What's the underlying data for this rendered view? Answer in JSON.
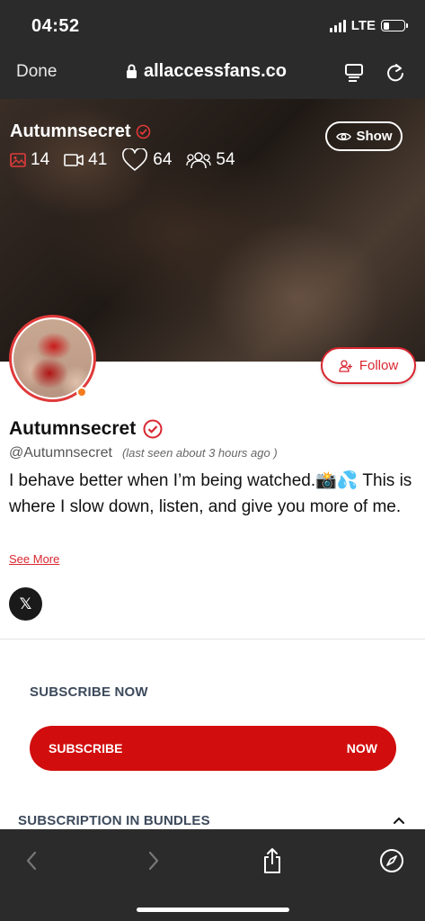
{
  "status": {
    "time": "04:52",
    "network": "LTE"
  },
  "browser": {
    "done_label": "Done",
    "url": "allaccessfans.co"
  },
  "cover": {
    "name": "Autumnsecret",
    "stats": {
      "photos": "14",
      "videos": "41",
      "likes": "64",
      "followers": "54"
    },
    "show_label": "Show"
  },
  "profile": {
    "follow_label": "Follow",
    "name": "Autumnsecret",
    "handle": "@Autumnsecret",
    "last_seen": "(last seen about 3 hours ago )",
    "bio": "I behave better when I’m being watched.📸💦 This is where I slow down, listen, and give you more of me.",
    "see_more": "See More",
    "social_x": "𝕏"
  },
  "subscribe": {
    "heading": "SUBSCRIBE NOW",
    "button_left": "SUBSCRIBE",
    "button_right": "NOW",
    "bundles_heading": "SUBSCRIPTION IN BUNDLES"
  },
  "colors": {
    "accent": "#d10d0d",
    "verified": "#d9262f",
    "online": "#f57c1f",
    "heading": "#3d4a5c"
  }
}
